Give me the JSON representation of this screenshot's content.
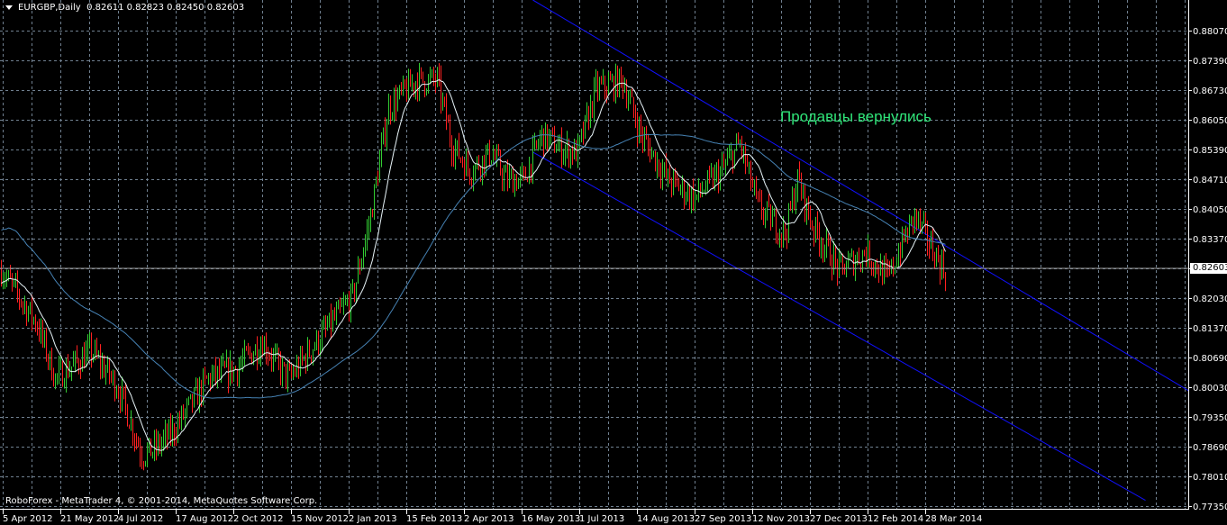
{
  "header": {
    "symbol": "EURGBP,Daily",
    "open": "0.82611",
    "high": "0.82823",
    "low": "0.82450",
    "close": "0.82603"
  },
  "copyright": "RoboForex - MetaTrader 4, © 2001-2014, MetaQuotes Software Corp.",
  "annotation": "Продавцы вернулись",
  "current_price": "0.82603",
  "colors": {
    "up": "#32cd32",
    "down": "#ff2020",
    "ma_fast": "#e8f4f8",
    "ma_slow": "#4682b4",
    "channel": "#1010ff",
    "grid": "#708090",
    "annotation": "#2fe478"
  },
  "chart_data": {
    "type": "bar",
    "title": "EURGBP,Daily",
    "ylim": [
      0.7735,
      0.8807
    ],
    "y_ticks": [
      "0.88070",
      "0.87390",
      "0.86730",
      "0.86050",
      "0.85390",
      "0.84710",
      "0.84050",
      "0.83370",
      "0.82710",
      "0.82030",
      "0.81370",
      "0.80690",
      "0.80030",
      "0.79350",
      "0.78690",
      "0.78010",
      "0.77350"
    ],
    "x_ticks": [
      "5 Apr 2012",
      "21 May 2012",
      "4 Jul 2012",
      "17 Aug 2012",
      "2 Oct 2012",
      "15 Nov 2012",
      "2 Jan 2013",
      "15 Feb 2013",
      "2 Apr 2013",
      "16 May 2013",
      "1 Jul 2013",
      "14 Aug 2013",
      "27 Sep 2013",
      "12 Nov 2013",
      "27 Dec 2013",
      "12 Feb 2014",
      "28 Mar 2014"
    ],
    "price_path": [
      [
        0,
        0.8267
      ],
      [
        20,
        0.8145
      ],
      [
        30,
        0.8023
      ],
      [
        50,
        0.8084
      ],
      [
        65,
        0.8002
      ],
      [
        78,
        0.7852
      ],
      [
        85,
        0.7862
      ],
      [
        95,
        0.7902
      ],
      [
        115,
        0.8023
      ],
      [
        130,
        0.8044
      ],
      [
        145,
        0.8105
      ],
      [
        155,
        0.8044
      ],
      [
        160,
        0.8023
      ],
      [
        175,
        0.8105
      ],
      [
        195,
        0.8206
      ],
      [
        205,
        0.8389
      ],
      [
        215,
        0.8633
      ],
      [
        230,
        0.8694
      ],
      [
        242,
        0.8694
      ],
      [
        250,
        0.8552
      ],
      [
        260,
        0.8491
      ],
      [
        272,
        0.8532
      ],
      [
        280,
        0.8471
      ],
      [
        290,
        0.8471
      ],
      [
        300,
        0.8572
      ],
      [
        310,
        0.8542
      ],
      [
        320,
        0.8532
      ],
      [
        330,
        0.8674
      ],
      [
        345,
        0.8694
      ],
      [
        355,
        0.8572
      ],
      [
        370,
        0.8471
      ],
      [
        385,
        0.843
      ],
      [
        400,
        0.8491
      ],
      [
        410,
        0.8552
      ],
      [
        420,
        0.841
      ],
      [
        435,
        0.8349
      ],
      [
        442,
        0.8471
      ],
      [
        450,
        0.8369
      ],
      [
        465,
        0.8267
      ],
      [
        480,
        0.8308
      ],
      [
        492,
        0.8247
      ],
      [
        500,
        0.8328
      ],
      [
        507,
        0.8389
      ],
      [
        515,
        0.8328
      ],
      [
        524,
        0.826
      ]
    ],
    "moving_averages": [
      {
        "name": "fast",
        "period": 14
      },
      {
        "name": "slow",
        "period": 90
      }
    ],
    "channel": {
      "upper": [
        [
          295,
          0.8876
        ],
        [
          659,
          0.7995
        ]
      ],
      "lower": [
        [
          295,
          0.8533
        ],
        [
          635,
          0.7748
        ]
      ]
    }
  }
}
